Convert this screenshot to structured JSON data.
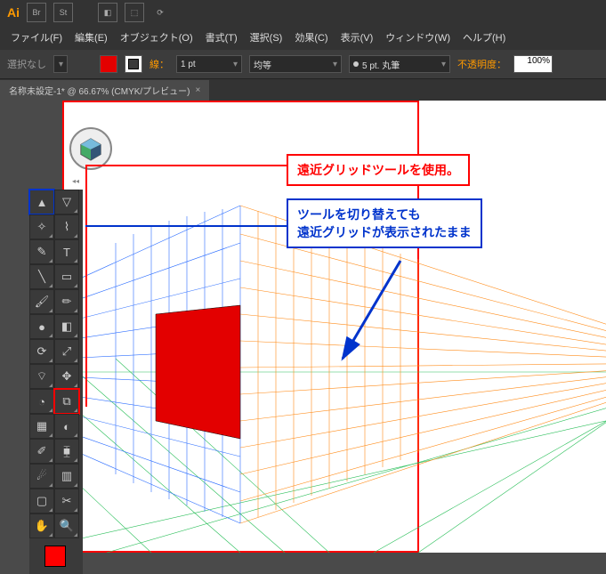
{
  "topbar": {
    "logo": "Ai",
    "icons": [
      "Br",
      "St",
      "◧",
      "⬚",
      "⟳"
    ]
  },
  "menu": [
    {
      "label": "ファイル(F)"
    },
    {
      "label": "編集(E)"
    },
    {
      "label": "オブジェクト(O)"
    },
    {
      "label": "書式(T)"
    },
    {
      "label": "選択(S)"
    },
    {
      "label": "効果(C)"
    },
    {
      "label": "表示(V)"
    },
    {
      "label": "ウィンドウ(W)"
    },
    {
      "label": "ヘルプ(H)"
    }
  ],
  "optbar": {
    "selection": "選択なし",
    "fill": "#e30000",
    "stroke": "#ffffff",
    "stroke_center": true,
    "stroke_label": "線：",
    "stroke_weight": "1 pt",
    "brush_label": "",
    "profile": "均等",
    "brush": "5 pt. 丸筆",
    "opacity_label": "不透明度：",
    "opacity": "100%"
  },
  "tab": {
    "title": "名称未設定-1* @ 66.67% (CMYK/プレビュー)",
    "close": "×"
  },
  "callouts": {
    "red": "遠近グリッドツールを使用。",
    "blue_line1": "ツールを切り替えても",
    "blue_line2": "遠近グリッドが表示されたまま"
  },
  "tools_grid": [
    [
      "selection",
      "direct-selection"
    ],
    [
      "magic-wand",
      "lasso"
    ],
    [
      "pen",
      "type"
    ],
    [
      "line",
      "rectangle"
    ],
    [
      "paintbrush",
      "pencil"
    ],
    [
      "blob-brush",
      "eraser"
    ],
    [
      "rotate",
      "scale"
    ],
    [
      "width",
      "free-transform"
    ],
    [
      "shape-builder",
      "perspective-grid"
    ],
    [
      "mesh",
      "gradient"
    ],
    [
      "eyedropper",
      "blend"
    ],
    [
      "symbol-sprayer",
      "column-graph"
    ],
    [
      "artboard",
      "slice"
    ],
    [
      "hand",
      "zoom"
    ]
  ],
  "highlights": {
    "selection": "blue",
    "perspective-grid": "red"
  }
}
